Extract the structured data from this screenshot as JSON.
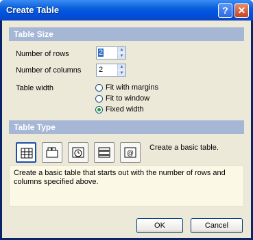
{
  "window": {
    "title": "Create Table",
    "help_label": "?",
    "close_label": "✕"
  },
  "table_size": {
    "header": "Table Size",
    "rows_label": "Number of rows",
    "rows_value": "2",
    "columns_label": "Number of columns",
    "columns_value": "2",
    "width_label": "Table width",
    "width_options": [
      {
        "label": "Fit with margins",
        "selected": false
      },
      {
        "label": "Fit to window",
        "selected": false
      },
      {
        "label": "Fixed width",
        "selected": true
      }
    ]
  },
  "table_type": {
    "header": "Table Type",
    "types": [
      {
        "icon": "basic-table-icon",
        "selected": true
      },
      {
        "icon": "tabbed-table-icon",
        "selected": false
      },
      {
        "icon": "clock-table-icon",
        "selected": false
      },
      {
        "icon": "striped-table-icon",
        "selected": false
      },
      {
        "icon": "email-table-icon",
        "selected": false
      }
    ],
    "type_caption": "Create a basic table.",
    "description": "Create a basic table that starts out with the number of rows and columns specified above."
  },
  "buttons": {
    "ok": "OK",
    "cancel": "Cancel"
  }
}
